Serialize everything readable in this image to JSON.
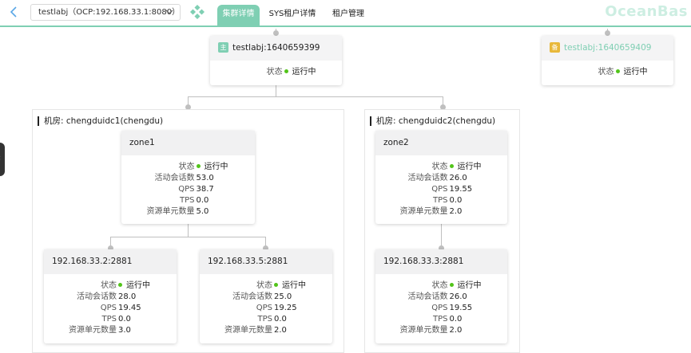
{
  "topbar": {
    "cluster_select": "testlabj（OCP:192.168.33.1:8080）",
    "tabs": [
      {
        "label": "集群详情",
        "active": true
      },
      {
        "label": "SYS租户详情",
        "active": false
      },
      {
        "label": "租户管理",
        "active": false
      }
    ],
    "logo": "OceanBas",
    "accent": "#7fcfb3"
  },
  "primary": {
    "tag": "主",
    "name": "testlabj:1640659399",
    "status_label": "状态",
    "status": "运行中"
  },
  "standby": {
    "tag": "备",
    "name": "testlabj:1640659409",
    "status_label": "状态",
    "status": "运行中"
  },
  "labels": {
    "status": "状态",
    "sessions": "活动会话数",
    "qps": "QPS",
    "tps": "TPS",
    "units": "资源单元数量"
  },
  "rooms": [
    {
      "title": "机房: chengduidc1(chengdu)",
      "zone": {
        "name": "zone1",
        "status": "运行中",
        "sessions": "53.0",
        "qps": "38.7",
        "tps": "0.0",
        "units": "5.0"
      },
      "servers": [
        {
          "name": "192.168.33.2:2881",
          "status": "运行中",
          "sessions": "28.0",
          "qps": "19.45",
          "tps": "0.0",
          "units": "3.0"
        },
        {
          "name": "192.168.33.5:2881",
          "status": "运行中",
          "sessions": "25.0",
          "qps": "19.25",
          "tps": "0.0",
          "units": "2.0"
        }
      ]
    },
    {
      "title": "机房: chengduidc2(chengdu)",
      "zone": {
        "name": "zone2",
        "status": "运行中",
        "sessions": "26.0",
        "qps": "19.55",
        "tps": "0.0",
        "units": "2.0"
      },
      "servers": [
        {
          "name": "192.168.33.3:2881",
          "status": "运行中",
          "sessions": "26.0",
          "qps": "19.55",
          "tps": "0.0",
          "units": "2.0"
        }
      ]
    }
  ]
}
